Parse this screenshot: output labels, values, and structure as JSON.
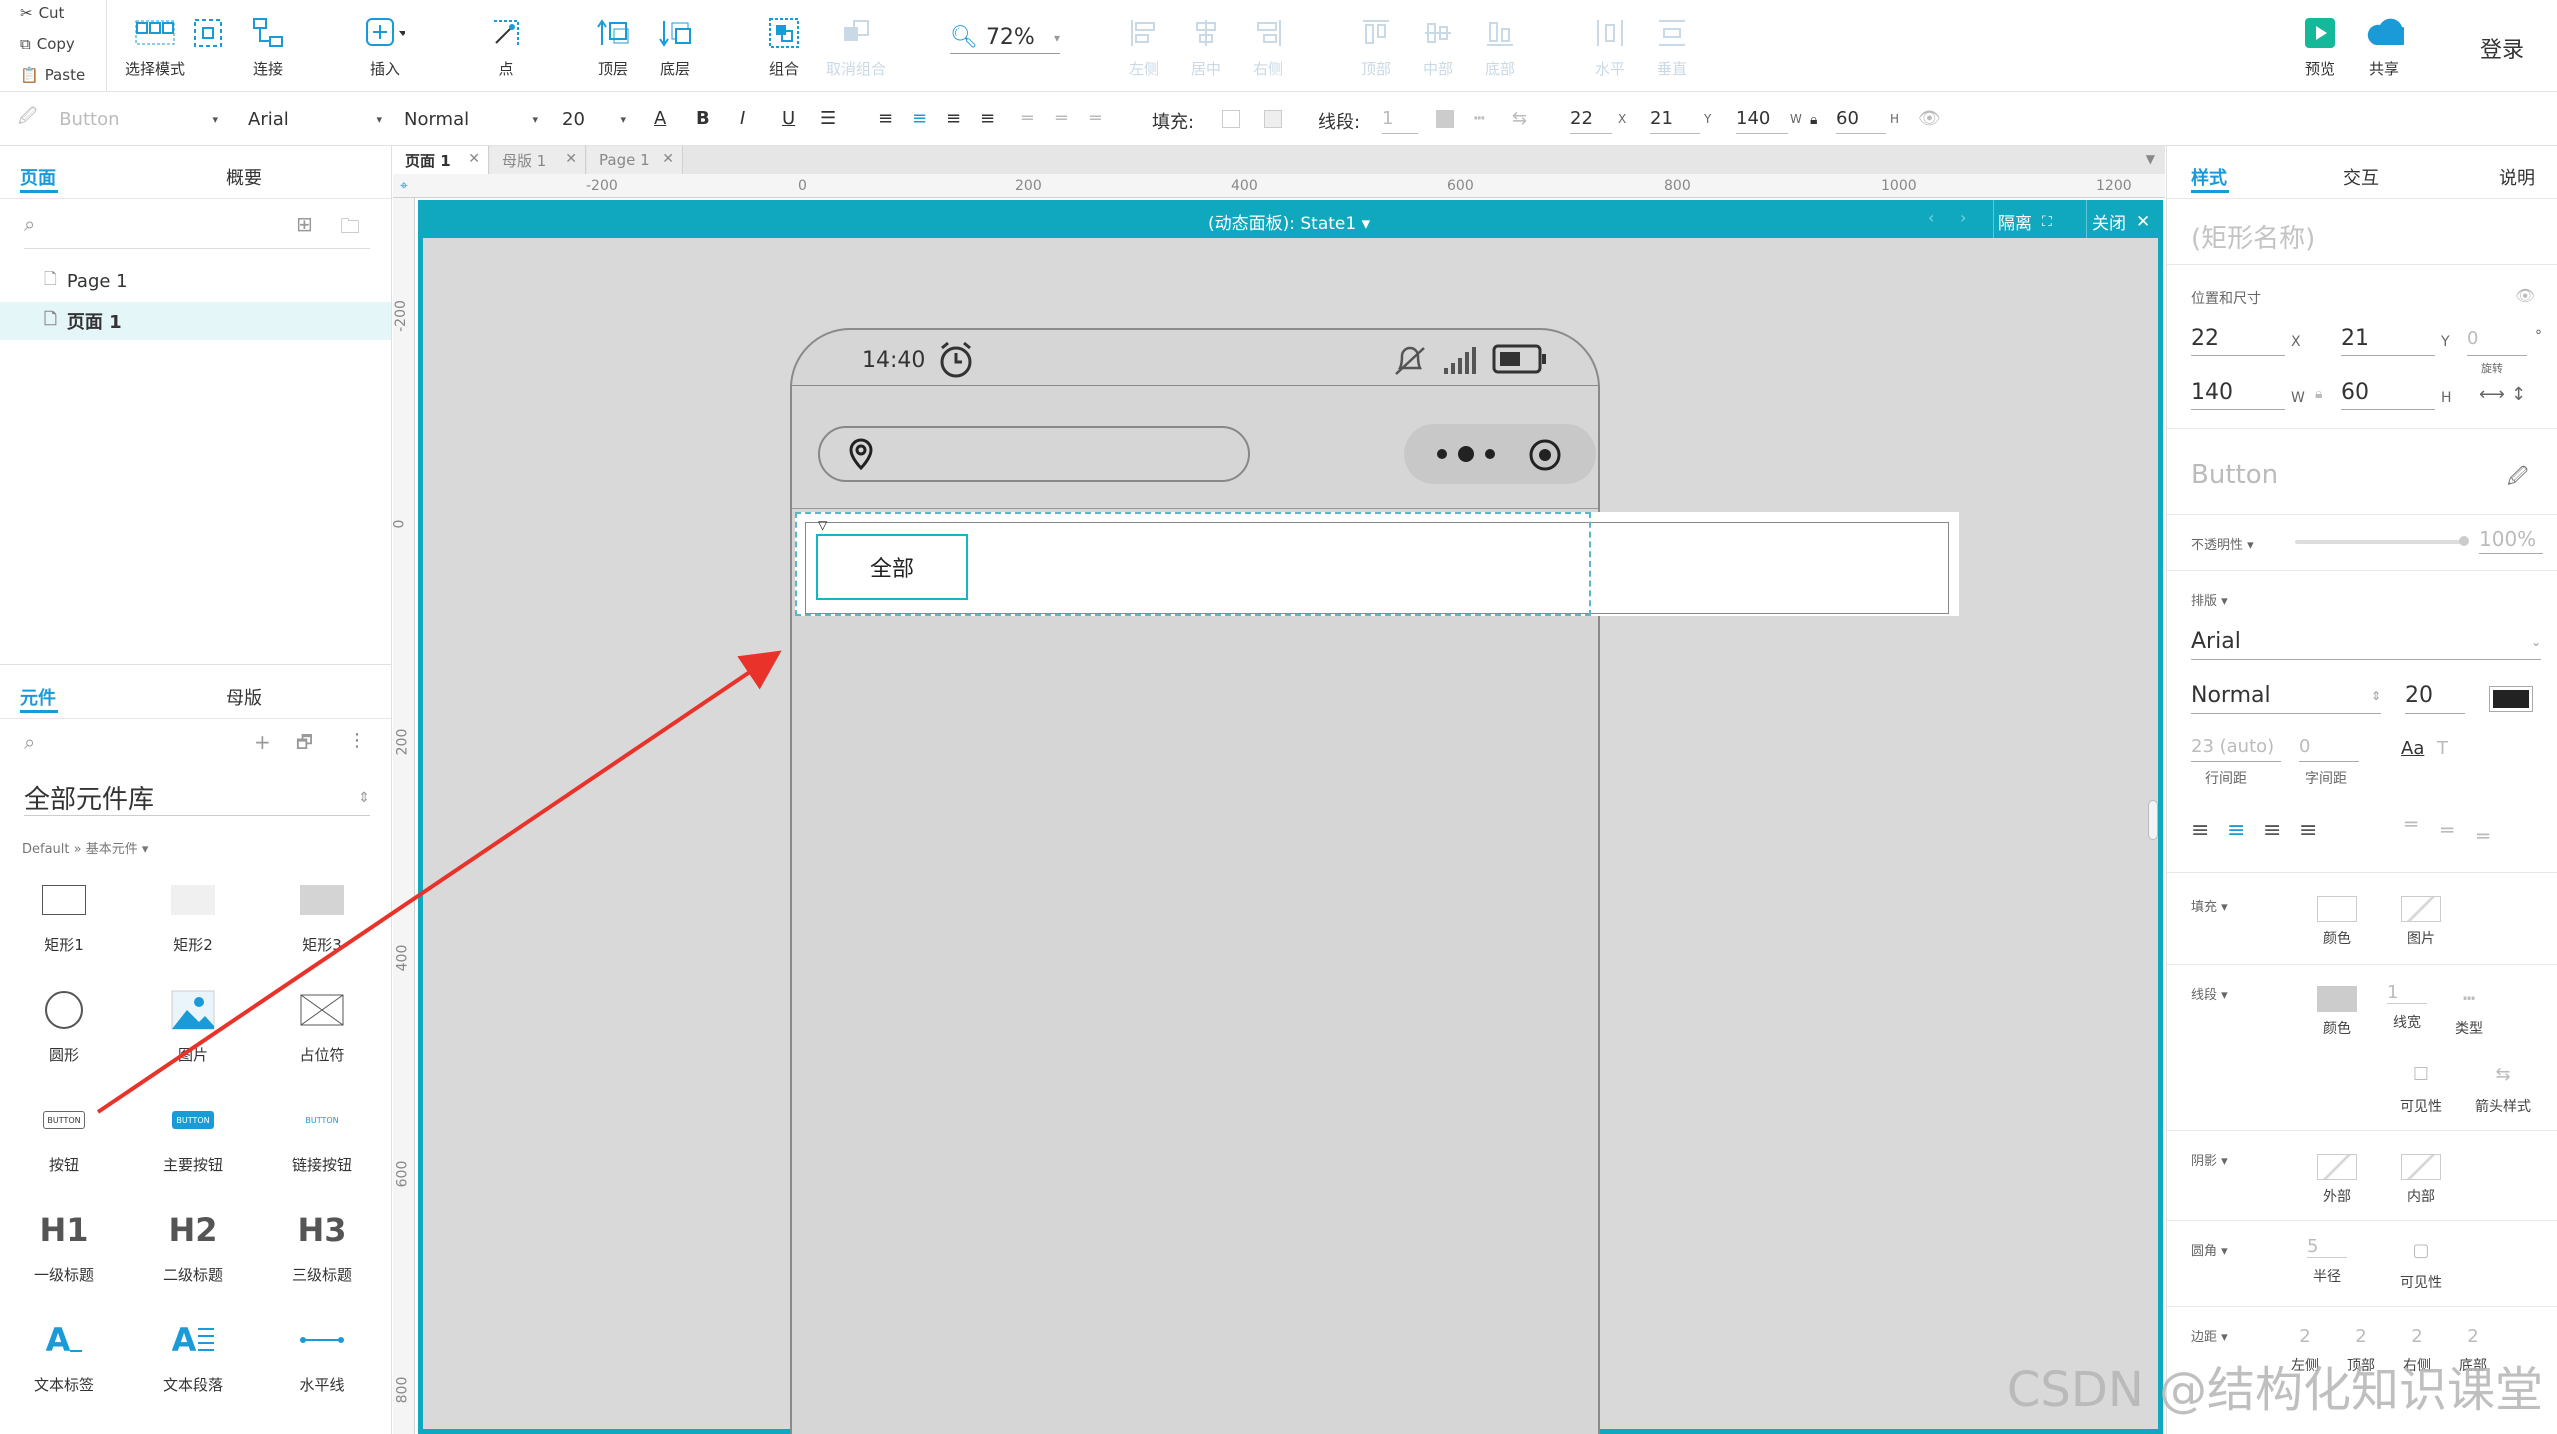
{
  "clipboard": {
    "cut": "Cut",
    "copy": "Copy",
    "paste": "Paste"
  },
  "toolbar": {
    "select_mode": "选择模式",
    "connect": "连接",
    "insert": "插入",
    "point": "点",
    "top_layer": "顶层",
    "bottom_layer": "底层",
    "group": "组合",
    "ungroup": "取消组合",
    "zoom": "72%",
    "align_left": "左侧",
    "align_center": "居中",
    "align_right": "右侧",
    "align_top": "顶部",
    "align_middle": "中部",
    "align_bottom": "底部",
    "dist_horizontal": "水平",
    "dist_vertical": "垂直",
    "preview": "预览",
    "share": "共享",
    "login": "登录"
  },
  "formatbar": {
    "widget_style": "Button",
    "font_family": "Arial",
    "font_weight": "Normal",
    "font_size": "20",
    "fill_label": "填充:",
    "line_label": "线段:",
    "line_width": "1",
    "x": "22",
    "x_label": "X",
    "y": "21",
    "y_label": "Y",
    "w": "140",
    "w_label": "W",
    "h": "60",
    "h_label": "H"
  },
  "left_panel": {
    "tab_pages": "页面",
    "tab_outline": "概要",
    "pages": [
      "Page 1",
      "页面 1"
    ],
    "tab_widgets": "元件",
    "tab_masters": "母版",
    "library_title": "全部元件库",
    "library_path": "Default » 基本元件 ▾",
    "widgets": [
      {
        "label": "矩形1",
        "icon": "rectangle1-icon"
      },
      {
        "label": "矩形2",
        "icon": "rectangle2-icon"
      },
      {
        "label": "矩形3",
        "icon": "rectangle3-icon"
      },
      {
        "label": "圆形",
        "icon": "circle-icon"
      },
      {
        "label": "图片",
        "icon": "image-icon"
      },
      {
        "label": "占位符",
        "icon": "placeholder-icon"
      },
      {
        "label": "按钮",
        "icon": "button-icon",
        "icon_text": "BUTTON"
      },
      {
        "label": "主要按钮",
        "icon": "primary-button-icon",
        "icon_text": "BUTTON"
      },
      {
        "label": "链接按钮",
        "icon": "link-button-icon",
        "icon_text": "BUTTON"
      },
      {
        "label": "一级标题",
        "icon": "h1-icon",
        "icon_text": "H1"
      },
      {
        "label": "二级标题",
        "icon": "h2-icon",
        "icon_text": "H2"
      },
      {
        "label": "三级标题",
        "icon": "h3-icon",
        "icon_text": "H3"
      },
      {
        "label": "文本标签",
        "icon": "text-label-icon",
        "icon_text": "A"
      },
      {
        "label": "文本段落",
        "icon": "text-paragraph-icon",
        "icon_text": "A"
      },
      {
        "label": "水平线",
        "icon": "horizontal-line-icon"
      }
    ]
  },
  "doc_tabs": [
    {
      "label": "页面 1",
      "active": true
    },
    {
      "label": "母版 1",
      "active": false
    },
    {
      "label": "Page 1",
      "active": false
    }
  ],
  "rulers": {
    "horizontal": [
      "-200",
      "0",
      "200",
      "400",
      "600",
      "800",
      "1000",
      "1200"
    ],
    "vertical": [
      "-200",
      "0",
      "200",
      "400",
      "600",
      "800"
    ]
  },
  "dynamic_panel": {
    "title": "(动态面板): State1 ▾",
    "isolate": "隔离",
    "close": "关闭"
  },
  "phone": {
    "time": "14:40",
    "button_text": "全部"
  },
  "right_panel": {
    "tab_style": "样式",
    "tab_interact": "交互",
    "tab_notes": "说明",
    "shape_name_placeholder": "(矩形名称)",
    "pos_size_label": "位置和尺寸",
    "x": "22",
    "x_label": "X",
    "y": "21",
    "y_label": "Y",
    "rotation": "0",
    "rotation_unit": "°",
    "rotation_label": "旋转",
    "w": "140",
    "w_label": "W",
    "h": "60",
    "h_label": "H",
    "widget_style": "Button",
    "opacity_label": "不透明性 ▾",
    "opacity_value": "100%",
    "typography_label": "排版 ▾",
    "font_family": "Arial",
    "font_weight": "Normal",
    "font_size": "20",
    "font_color": "#222222",
    "line_height": "23 (auto)",
    "line_height_label": "行间距",
    "letter_spacing": "0",
    "letter_spacing_label": "字间距",
    "fill_label": "填充 ▾",
    "fill_color": "颜色",
    "fill_image": "图片",
    "border_label": "线段 ▾",
    "border_color": "颜色",
    "border_width": "1",
    "border_width_label": "线宽",
    "border_type": "类型",
    "visibility": "可见性",
    "arrow_style": "箭头样式",
    "shadow_label": "阴影 ▾",
    "shadow_outer": "外部",
    "shadow_inner": "内部",
    "corner_label": "圆角 ▾",
    "corner_radius": "5",
    "corner_radius_label": "半径",
    "corner_visibility": "可见性",
    "padding_label": "边距 ▾",
    "padding_values": [
      "2",
      "2",
      "2",
      "2"
    ],
    "padding_names": [
      "左侧",
      "顶部",
      "右侧",
      "底部"
    ]
  },
  "watermark": "CSDN @结构化知识课堂",
  "colors": {
    "accent": "#1a9bd7",
    "panel_teal": "#10a8bf",
    "arrow_red": "#e8322a"
  }
}
